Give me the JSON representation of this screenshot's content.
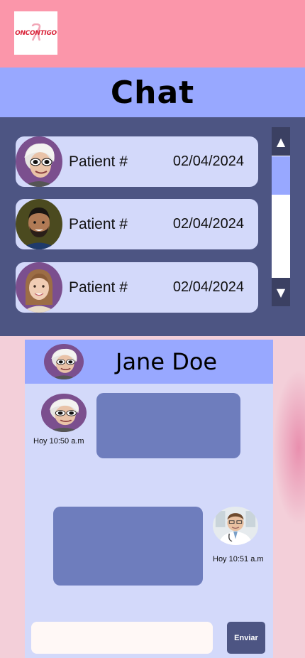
{
  "brand": {
    "logo_text": "ONCONTIGO"
  },
  "header": {
    "title": "Chat"
  },
  "patients": [
    {
      "label": "Patient #",
      "date": "02/04/2024",
      "avatar": "elderly-woman-sunglasses-avatar"
    },
    {
      "label": "Patient #",
      "date": "02/04/2024",
      "avatar": "bearded-man-avatar"
    },
    {
      "label": "Patient #",
      "date": "02/04/2024",
      "avatar": "young-woman-avatar"
    }
  ],
  "scrollbar": {
    "up_glyph": "▲",
    "down_glyph": "▼",
    "up_icon": "arrow-up-icon",
    "down_icon": "arrow-down-icon"
  },
  "chat": {
    "contact_name": "Jane Doe",
    "messages": [
      {
        "sender": "patient",
        "time": "Hoy 10:50 a.m"
      },
      {
        "sender": "doctor",
        "time": "Hoy 10:51 a.m"
      }
    ]
  },
  "composer": {
    "value": "",
    "send_label": "Enviar"
  },
  "colors": {
    "top_bar": "#fb96aa",
    "title_bar": "#98a8ff",
    "list_bg": "#4d5583",
    "card_bg": "#d3d9fa",
    "bubble": "#6e7dbd",
    "send_button": "#4d5583"
  }
}
